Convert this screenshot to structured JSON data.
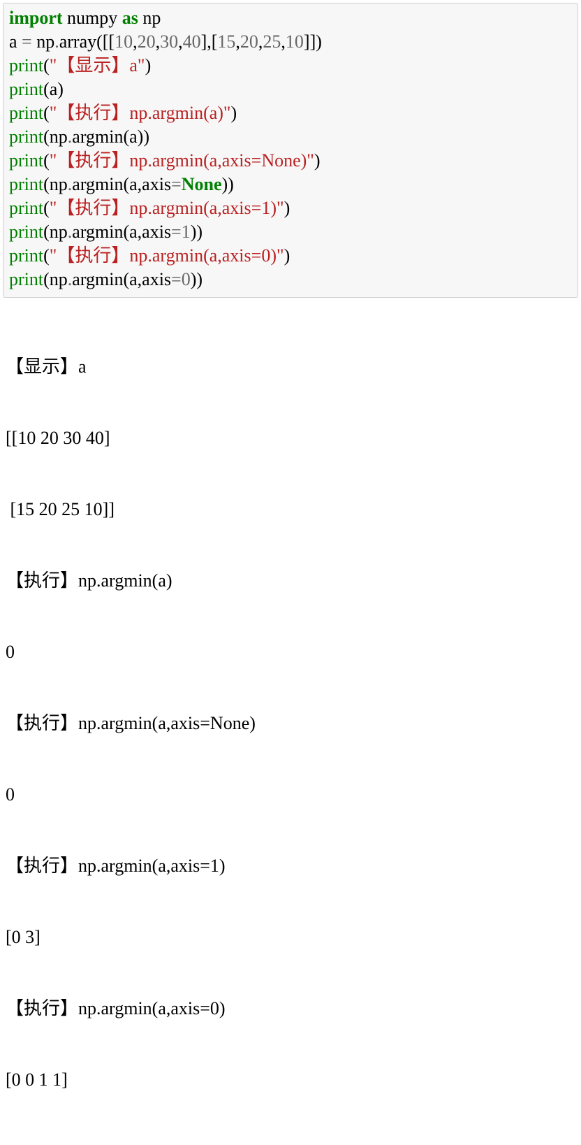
{
  "code": {
    "l1": {
      "s1": "import",
      "s2": " numpy ",
      "s3": "as",
      "s4": " np"
    },
    "l2": "",
    "l3": {
      "s1": "a ",
      "s2": "=",
      "s3": " np",
      "s4": ".",
      "s5": "array([[",
      "n1": "10",
      "c1": ",",
      "n2": "20",
      "c2": ",",
      "n3": "30",
      "c3": ",",
      "n4": "40",
      "s6": "],[",
      "n5": "15",
      "c4": ",",
      "n6": "20",
      "c5": ",",
      "n7": "25",
      "c6": ",",
      "n8": "10",
      "s7": "]])"
    },
    "l4": {
      "s1": "print",
      "s2": "(",
      "s3": "\"【显示】a\"",
      "s4": ")"
    },
    "l5": {
      "s1": "print",
      "s2": "(a)"
    },
    "l6": {
      "s1": "print",
      "s2": "(",
      "s3": "\"【执行】np.argmin(a)\"",
      "s4": ")"
    },
    "l7": {
      "s1": "print",
      "s2": "(np",
      "s3": ".",
      "s4": "argmin(a))"
    },
    "l8": {
      "s1": "print",
      "s2": "(",
      "s3": "\"【执行】np.argmin(a,axis=None)\"",
      "s4": ")"
    },
    "l9": {
      "s1": "print",
      "s2": "(np",
      "s3": ".",
      "s4": "argmin(a,axis",
      "s5": "=",
      "s6": "None",
      "s7": "))"
    },
    "l10": {
      "s1": "print",
      "s2": "(",
      "s3": "\"【执行】np.argmin(a,axis=1)\"",
      "s4": ")"
    },
    "l11": {
      "s1": "print",
      "s2": "(np",
      "s3": ".",
      "s4": "argmin(a,axis",
      "s5": "=",
      "n1": "1",
      "s6": "))"
    },
    "l12": {
      "s1": "print",
      "s2": "(",
      "s3": "\"【执行】np.argmin(a,axis=0)\"",
      "s4": ")"
    },
    "l13": {
      "s1": "print",
      "s2": "(np",
      "s3": ".",
      "s4": "argmin(a,axis",
      "s5": "=",
      "n1": "0",
      "s6": "))"
    }
  },
  "output": {
    "o1": "【显示】a",
    "o2": "[[10 20 30 40]",
    "o3": " [15 20 25 10]]",
    "o4": "【执行】np.argmin(a)",
    "o5": "0",
    "o6": "【执行】np.argmin(a,axis=None)",
    "o7": "0",
    "o8": "【执行】np.argmin(a,axis=1)",
    "o9": "[0 3]",
    "o10": "【执行】np.argmin(a,axis=0)",
    "o11": "[0 0 1 1]"
  }
}
